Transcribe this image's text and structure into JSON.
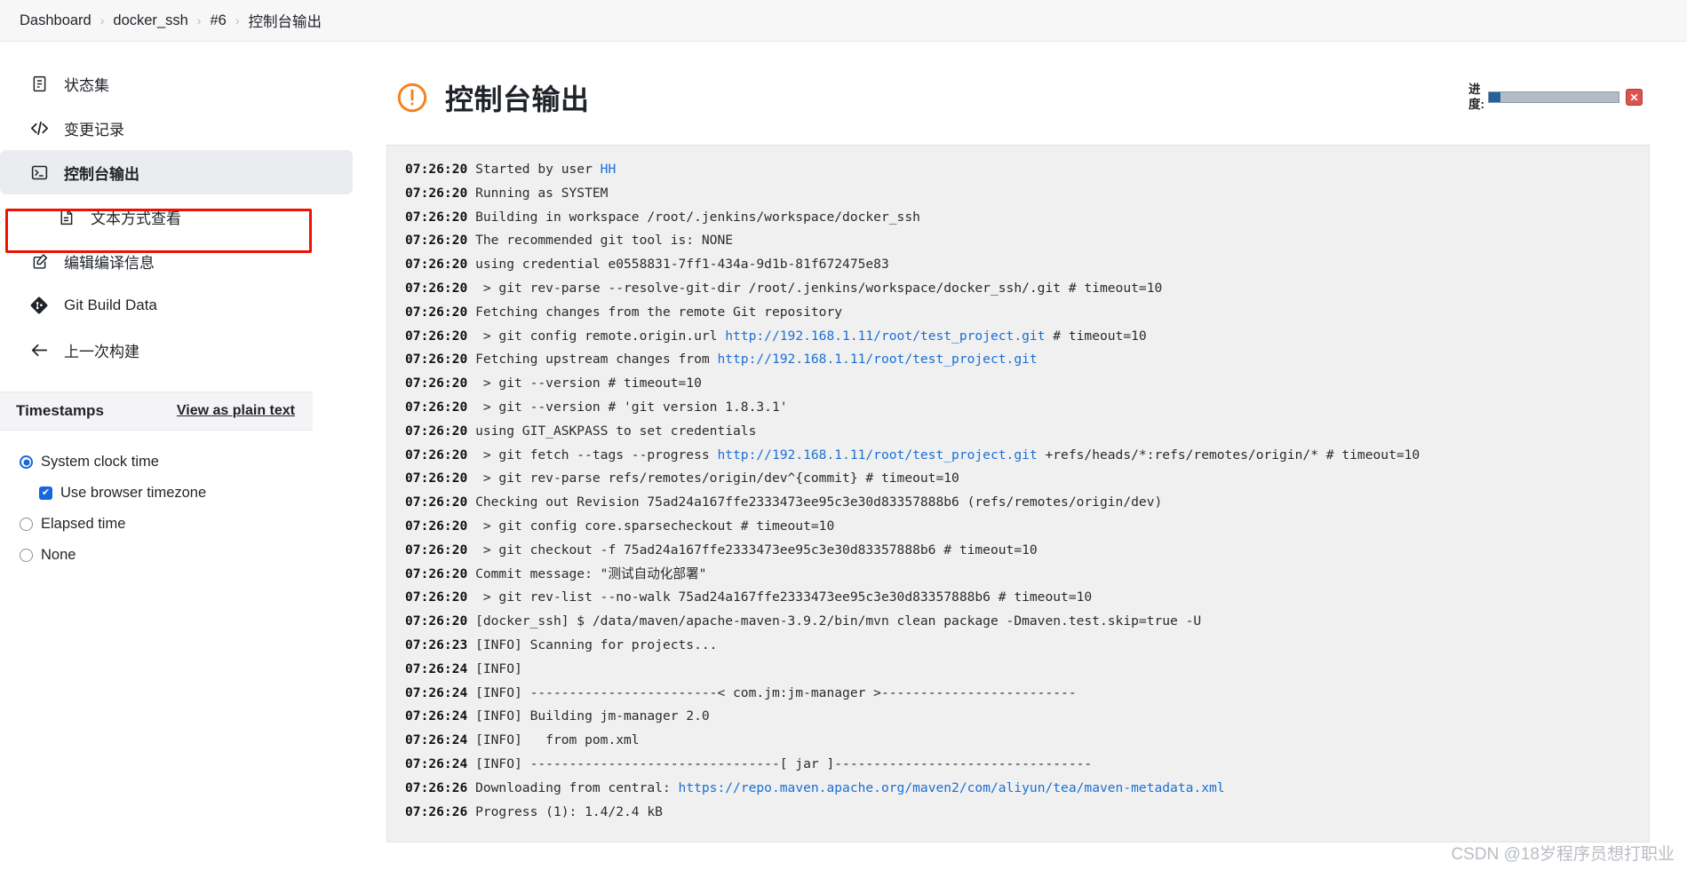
{
  "breadcrumb": {
    "separator": "›",
    "items": [
      {
        "label": "Dashboard"
      },
      {
        "label": "docker_ssh"
      },
      {
        "label": "#6"
      },
      {
        "label": "控制台输出"
      }
    ]
  },
  "sidebar": {
    "items": [
      {
        "label": "状态集",
        "icon": "status-set-icon"
      },
      {
        "label": "变更记录",
        "icon": "code-brackets-icon"
      },
      {
        "label": "控制台输出",
        "icon": "terminal-icon"
      },
      {
        "label": "文本方式查看",
        "icon": "document-icon"
      },
      {
        "label": "编辑编译信息",
        "icon": "edit-square-icon"
      },
      {
        "label": "Git Build Data",
        "icon": "git-icon"
      },
      {
        "label": "上一次构建",
        "icon": "arrow-left-icon"
      }
    ]
  },
  "timestamps": {
    "title": "Timestamps",
    "plain_text_link": "View as plain text",
    "options": [
      {
        "label": "System clock time",
        "type": "radio",
        "checked": true
      },
      {
        "label": "Use browser timezone",
        "type": "checkbox",
        "checked": true
      },
      {
        "label": "Elapsed time",
        "type": "radio",
        "checked": false
      },
      {
        "label": "None",
        "type": "radio",
        "checked": false
      }
    ],
    "checkmark": "✔"
  },
  "main": {
    "page_title": "控制台输出",
    "warning_icon": "warning-circle-icon"
  },
  "progress": {
    "label": "进度:",
    "percent": 9,
    "fill_color": "#24609d",
    "track_color": "#b3bcc6",
    "stop_button_label": "✕",
    "stop_button_color": "#d9534f"
  },
  "console": {
    "lines": [
      {
        "ts": "07:26:20",
        "parts": [
          {
            "t": "Started by user "
          },
          {
            "t": "HH",
            "link": true
          }
        ]
      },
      {
        "ts": "07:26:20",
        "parts": [
          {
            "t": "Running as SYSTEM"
          }
        ]
      },
      {
        "ts": "07:26:20",
        "parts": [
          {
            "t": "Building in workspace /root/.jenkins/workspace/docker_ssh"
          }
        ]
      },
      {
        "ts": "07:26:20",
        "parts": [
          {
            "t": "The recommended git tool is: NONE"
          }
        ]
      },
      {
        "ts": "07:26:20",
        "parts": [
          {
            "t": "using credential e0558831-7ff1-434a-9d1b-81f672475e83"
          }
        ]
      },
      {
        "ts": "07:26:20",
        "parts": [
          {
            "t": " > git rev-parse --resolve-git-dir /root/.jenkins/workspace/docker_ssh/.git # timeout=10"
          }
        ]
      },
      {
        "ts": "07:26:20",
        "parts": [
          {
            "t": "Fetching changes from the remote Git repository"
          }
        ]
      },
      {
        "ts": "07:26:20",
        "parts": [
          {
            "t": " > git config remote.origin.url "
          },
          {
            "t": "http://192.168.1.11/root/test_project.git",
            "link": true
          },
          {
            "t": " # timeout=10"
          }
        ]
      },
      {
        "ts": "07:26:20",
        "parts": [
          {
            "t": "Fetching upstream changes from "
          },
          {
            "t": "http://192.168.1.11/root/test_project.git",
            "link": true
          }
        ]
      },
      {
        "ts": "07:26:20",
        "parts": [
          {
            "t": " > git --version # timeout=10"
          }
        ]
      },
      {
        "ts": "07:26:20",
        "parts": [
          {
            "t": " > git --version # 'git version 1.8.3.1'"
          }
        ]
      },
      {
        "ts": "07:26:20",
        "parts": [
          {
            "t": "using GIT_ASKPASS to set credentials"
          }
        ]
      },
      {
        "ts": "07:26:20",
        "parts": [
          {
            "t": " > git fetch --tags --progress "
          },
          {
            "t": "http://192.168.1.11/root/test_project.git",
            "link": true
          },
          {
            "t": " +refs/heads/*:refs/remotes/origin/* # timeout=10"
          }
        ]
      },
      {
        "ts": "07:26:20",
        "parts": [
          {
            "t": " > git rev-parse refs/remotes/origin/dev^{commit} # timeout=10"
          }
        ]
      },
      {
        "ts": "07:26:20",
        "parts": [
          {
            "t": "Checking out Revision 75ad24a167ffe2333473ee95c3e30d83357888b6 (refs/remotes/origin/dev)"
          }
        ]
      },
      {
        "ts": "07:26:20",
        "parts": [
          {
            "t": " > git config core.sparsecheckout # timeout=10"
          }
        ]
      },
      {
        "ts": "07:26:20",
        "parts": [
          {
            "t": " > git checkout -f 75ad24a167ffe2333473ee95c3e30d83357888b6 # timeout=10"
          }
        ]
      },
      {
        "ts": "07:26:20",
        "parts": [
          {
            "t": "Commit message: \"测试自动化部署\""
          }
        ]
      },
      {
        "ts": "07:26:20",
        "parts": [
          {
            "t": " > git rev-list --no-walk 75ad24a167ffe2333473ee95c3e30d83357888b6 # timeout=10"
          }
        ]
      },
      {
        "ts": "07:26:20",
        "parts": [
          {
            "t": "[docker_ssh] $ /data/maven/apache-maven-3.9.2/bin/mvn clean package -Dmaven.test.skip=true -U"
          }
        ]
      },
      {
        "ts": "07:26:23",
        "parts": [
          {
            "t": "[INFO] Scanning for projects..."
          }
        ]
      },
      {
        "ts": "07:26:24",
        "parts": [
          {
            "t": "[INFO]"
          }
        ]
      },
      {
        "ts": "07:26:24",
        "parts": [
          {
            "t": "[INFO] ------------------------< com.jm:jm-manager >-------------------------"
          }
        ]
      },
      {
        "ts": "07:26:24",
        "parts": [
          {
            "t": "[INFO] Building jm-manager 2.0"
          }
        ]
      },
      {
        "ts": "07:26:24",
        "parts": [
          {
            "t": "[INFO]   from pom.xml"
          }
        ]
      },
      {
        "ts": "07:26:24",
        "parts": [
          {
            "t": "[INFO] --------------------------------[ jar ]---------------------------------"
          }
        ]
      },
      {
        "ts": "07:26:26",
        "parts": [
          {
            "t": "Downloading from central: "
          },
          {
            "t": "https://repo.maven.apache.org/maven2/com/aliyun/tea/maven-metadata.xml",
            "link": true
          }
        ]
      },
      {
        "ts": "07:26:26",
        "parts": [
          {
            "t": "Progress (1): 1.4/2.4 kB"
          }
        ]
      }
    ]
  },
  "watermark": {
    "text": "CSDN @18岁程序员想打职业"
  }
}
